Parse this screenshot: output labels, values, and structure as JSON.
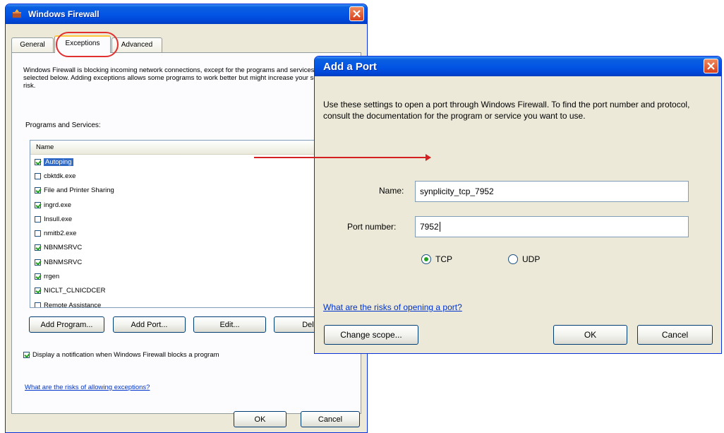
{
  "firewall": {
    "title": "Windows Firewall",
    "tabs": [
      "General",
      "Exceptions",
      "Advanced"
    ],
    "description": "Windows Firewall is blocking incoming network connections, except for the programs and services selected below. Adding exceptions allows some programs to work better but might increase your security risk.",
    "list_label": "Programs and Services:",
    "column_name": "Name",
    "programs": [
      {
        "label": "Autoping",
        "checked": true,
        "selected": true
      },
      {
        "label": "cbktdk.exe",
        "checked": false,
        "selected": false
      },
      {
        "label": "File and Printer Sharing",
        "checked": true,
        "selected": false
      },
      {
        "label": "ingrd.exe",
        "checked": true,
        "selected": false
      },
      {
        "label": "Insull.exe",
        "checked": false,
        "selected": false
      },
      {
        "label": "nmitb2.exe",
        "checked": false,
        "selected": false
      },
      {
        "label": "NBNMSRVC",
        "checked": true,
        "selected": false
      },
      {
        "label": "NBNMSRVC",
        "checked": true,
        "selected": false
      },
      {
        "label": "rrgen",
        "checked": true,
        "selected": false
      },
      {
        "label": "NICLT_CLNICDCER",
        "checked": true,
        "selected": false
      },
      {
        "label": "Remote Assistance",
        "checked": false,
        "selected": false
      }
    ],
    "buttons": {
      "add_program": "Add Program...",
      "add_port": "Add Port...",
      "edit": "Edit...",
      "delete": "Dele"
    },
    "notify_label": "Display a notification when Windows Firewall blocks a program",
    "notify_checked": true,
    "risk_link": "What are the risks of allowing exceptions?",
    "ok": "OK",
    "cancel": "Cancel"
  },
  "add_port": {
    "title": "Add a Port",
    "description": "Use these settings to open a port through Windows Firewall. To find the port number and protocol, consult the documentation for the program or service you want to use.",
    "name_label": "Name:",
    "name_value": "synplicity_tcp_7952",
    "port_label": "Port number:",
    "port_value": "7952",
    "tcp_label": "TCP",
    "udp_label": "UDP",
    "protocol_selected": "TCP",
    "risk_link": "What are the risks of opening a port?",
    "change_scope": "Change scope...",
    "ok": "OK",
    "cancel": "Cancel"
  },
  "colors": {
    "title_bar": "#0254e4",
    "annotation": "#e03030",
    "link": "#0033cc"
  }
}
